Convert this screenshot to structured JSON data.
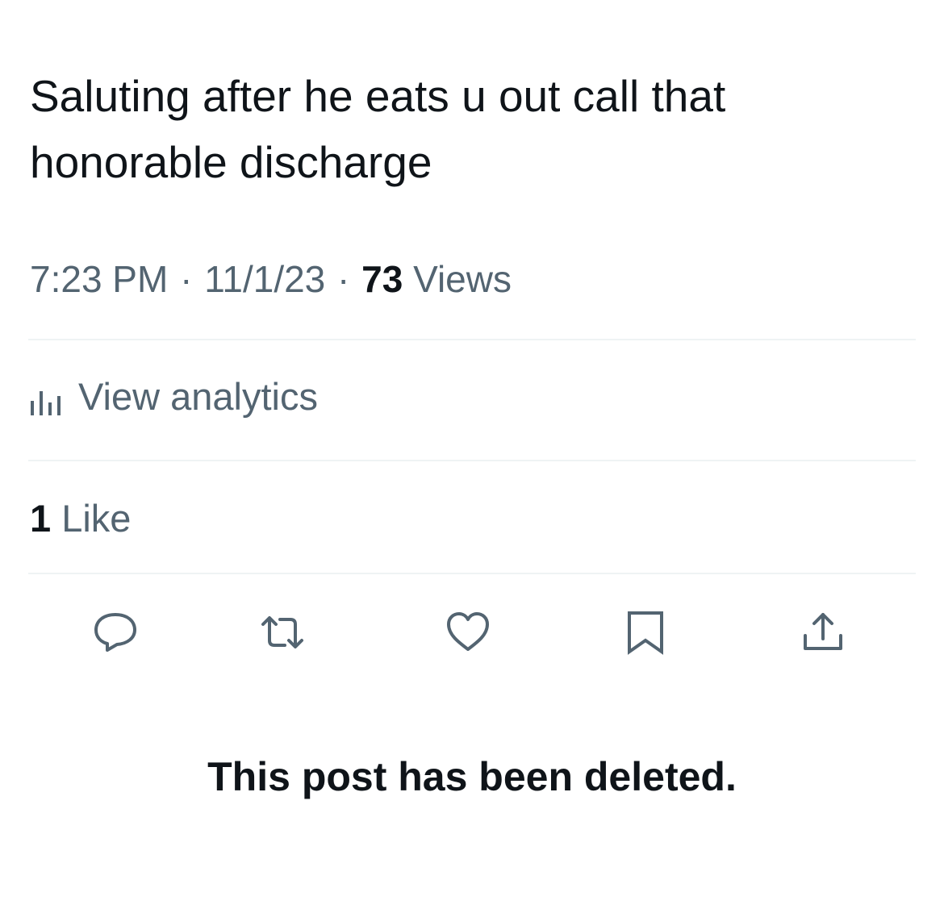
{
  "tweet": {
    "text": "Saluting after he eats u out call that\nhonorable discharge"
  },
  "meta": {
    "time": "7:23 PM",
    "separator": "·",
    "date": "11/1/23",
    "views_count": "73",
    "views_label": "Views"
  },
  "analytics": {
    "icon": "bar-chart-icon",
    "label": "View analytics"
  },
  "likes": {
    "count": "1",
    "label": "Like"
  },
  "actions": [
    {
      "name": "reply",
      "icon": "reply-icon"
    },
    {
      "name": "retweet",
      "icon": "retweet-icon"
    },
    {
      "name": "like",
      "icon": "heart-icon"
    },
    {
      "name": "bookmark",
      "icon": "bookmark-icon"
    },
    {
      "name": "share",
      "icon": "share-icon"
    }
  ],
  "notice": {
    "text": "This post has been deleted."
  },
  "colors": {
    "text": "#0f1419",
    "secondary": "#536471",
    "divider": "#eff3f4",
    "background": "#ffffff"
  }
}
